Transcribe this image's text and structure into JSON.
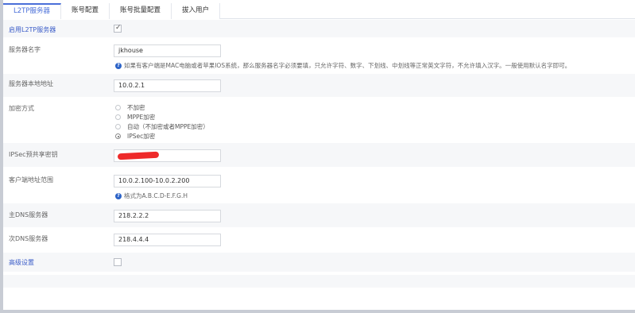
{
  "tabs": [
    {
      "label": "L2TP服务器",
      "active": true
    },
    {
      "label": "账号配置",
      "active": false
    },
    {
      "label": "账号批量配置",
      "active": false
    },
    {
      "label": "拔入用户",
      "active": false
    }
  ],
  "form": {
    "enable": {
      "label": "启用L2TP服务器",
      "checked": true,
      "check_glyph": "✓"
    },
    "server_name": {
      "label": "服务器名字",
      "value": "jkhouse",
      "hint": "如果有客户端是MAC电脑或者苹果IOS系统，那么服务器名字必须要填，只允许字符、数字、下划线、中划线等正常英文字符，不允许填入汉字。一般使用默认名字即可。"
    },
    "local_address": {
      "label": "服务器本地地址",
      "value": "10.0.2.1"
    },
    "encryption": {
      "label": "加密方式",
      "options": [
        {
          "label": "不加密",
          "selected": false
        },
        {
          "label": "MPPE加密",
          "selected": false
        },
        {
          "label": "自动（不加密或者MPPE加密）",
          "selected": false
        },
        {
          "label": "IPSec加密",
          "selected": true
        }
      ]
    },
    "ipsec_psk": {
      "label": "IPSec预共享密钥",
      "value": ""
    },
    "client_range": {
      "label": "客户端地址范围",
      "value": "10.0.2.100-10.0.2.200",
      "hint": "格式为A.B.C.D-E.F.G.H"
    },
    "primary_dns": {
      "label": "主DNS服务器",
      "value": "218.2.2.2"
    },
    "secondary_dns": {
      "label": "次DNS服务器",
      "value": "218.4.4.4"
    },
    "advanced": {
      "label": "高级设置",
      "checked": false
    }
  },
  "icons": {
    "help": "question-circle-icon",
    "help_glyph": "?"
  },
  "colors": {
    "accent": "#4a6fd9",
    "link": "#3b5cc8",
    "help_icon": "#2c63c7",
    "redaction": "#ee2a2a"
  }
}
